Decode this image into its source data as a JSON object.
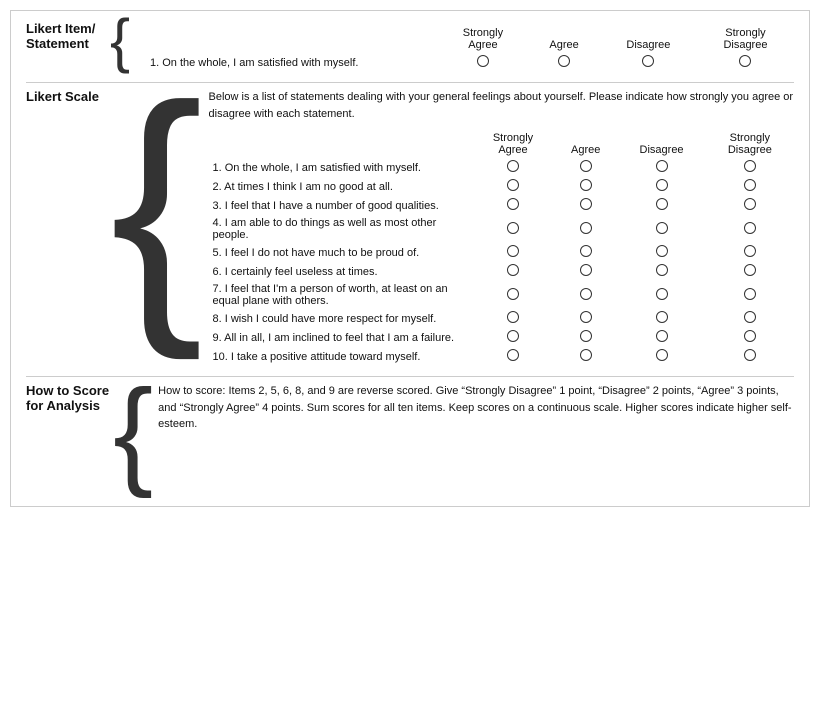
{
  "sections": {
    "item_statement": {
      "label": "Likert Item/\nStatement",
      "columns": [
        "Strongly\nAgree",
        "Agree",
        "Disagree",
        "Strongly\nDisagree"
      ],
      "row": "1. On the whole, I am satisfied with myself."
    },
    "likert_scale": {
      "label": "Likert Scale",
      "instructions": "Below is a list of statements dealing with your general feelings about yourself. Please indicate how strongly you agree or disagree with each statement.",
      "columns": [
        "Strongly\nAgree",
        "Agree",
        "Disagree",
        "Strongly\nDisagree"
      ],
      "rows": [
        "1. On the whole, I am satisfied with myself.",
        "2. At times I think I am no good at all.",
        "3. I feel that I have a number of good qualities.",
        "4. I am able to do things as well as most other people.",
        "5. I feel I do not have much to be proud of.",
        "6. I certainly feel useless at times.",
        "7. I feel that I'm a person of worth, at least on an equal plane with others.",
        "8. I wish I could have more respect for myself.",
        "9. All in all, I am inclined to feel that I am a failure.",
        "10. I take a positive attitude toward myself."
      ]
    },
    "how_to_score": {
      "label": "How to Score\nfor Analysis",
      "text": "How to score: Items 2, 5, 6, 8, and 9 are reverse scored. Give “Strongly Disagree” 1 point, “Disagree” 2 points, “Agree” 3 points, and “Strongly Agree” 4 points. Sum scores for all ten items. Keep scores on a continuous scale. Higher scores indicate higher self-esteem."
    }
  }
}
